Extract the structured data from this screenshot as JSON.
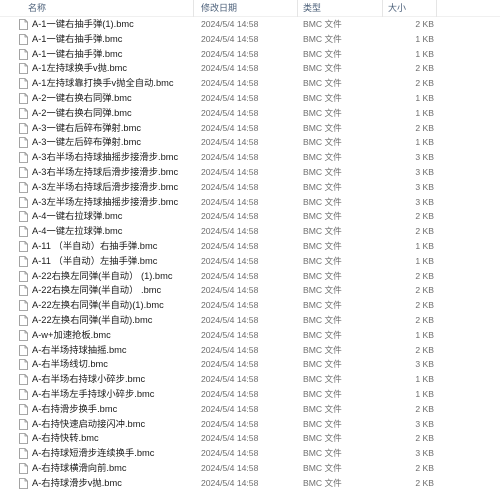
{
  "header": {
    "name_label": "名称",
    "date_label": "修改日期",
    "type_label": "类型",
    "size_label": "大小"
  },
  "files": [
    {
      "name": "A-1一键右抽手弹(1).bmc",
      "date": "2024/5/4 14:58",
      "type": "BMC 文件",
      "size": "2 KB"
    },
    {
      "name": "A-1一键右抽手弹.bmc",
      "date": "2024/5/4 14:58",
      "type": "BMC 文件",
      "size": "1 KB"
    },
    {
      "name": "A-1一键右抽手弹.bmc",
      "date": "2024/5/4 14:58",
      "type": "BMC 文件",
      "size": "1 KB"
    },
    {
      "name": "A-1左持球换手v抛.bmc",
      "date": "2024/5/4 14:58",
      "type": "BMC 文件",
      "size": "2 KB"
    },
    {
      "name": "A-1左持球靠打换手v抛全自动.bmc",
      "date": "2024/5/4 14:58",
      "type": "BMC 文件",
      "size": "2 KB"
    },
    {
      "name": "A-2一键右换右同弹.bmc",
      "date": "2024/5/4 14:58",
      "type": "BMC 文件",
      "size": "1 KB"
    },
    {
      "name": "A-2一键右换右同弹.bmc",
      "date": "2024/5/4 14:58",
      "type": "BMC 文件",
      "size": "1 KB"
    },
    {
      "name": "A-3一键右后碎布弹射.bmc",
      "date": "2024/5/4 14:58",
      "type": "BMC 文件",
      "size": "2 KB"
    },
    {
      "name": "A-3一键左后碎布弹射.bmc",
      "date": "2024/5/4 14:58",
      "type": "BMC 文件",
      "size": "1 KB"
    },
    {
      "name": "A-3右半场右持球抽摇步接滑步.bmc",
      "date": "2024/5/4 14:58",
      "type": "BMC 文件",
      "size": "3 KB"
    },
    {
      "name": "A-3右半场左持球后滑步接滑步.bmc",
      "date": "2024/5/4 14:58",
      "type": "BMC 文件",
      "size": "3 KB"
    },
    {
      "name": "A-3左半场右持球后滑步接滑步.bmc",
      "date": "2024/5/4 14:58",
      "type": "BMC 文件",
      "size": "3 KB"
    },
    {
      "name": "A-3左半场左持球抽摇步接滑步.bmc",
      "date": "2024/5/4 14:58",
      "type": "BMC 文件",
      "size": "3 KB"
    },
    {
      "name": "A-4一键右拉球弹.bmc",
      "date": "2024/5/4 14:58",
      "type": "BMC 文件",
      "size": "2 KB"
    },
    {
      "name": "A-4一键左拉球弹.bmc",
      "date": "2024/5/4 14:58",
      "type": "BMC 文件",
      "size": "2 KB"
    },
    {
      "name": "A-11 （半自动）右抽手弹.bmc",
      "date": "2024/5/4 14:58",
      "type": "BMC 文件",
      "size": "1 KB"
    },
    {
      "name": "A-11 （半自动）左抽手弹.bmc",
      "date": "2024/5/4 14:58",
      "type": "BMC 文件",
      "size": "1 KB"
    },
    {
      "name": "A-22右换左同弹(半自动） (1).bmc",
      "date": "2024/5/4 14:58",
      "type": "BMC 文件",
      "size": "2 KB"
    },
    {
      "name": "A-22右换左同弹(半自动） .bmc",
      "date": "2024/5/4 14:58",
      "type": "BMC 文件",
      "size": "2 KB"
    },
    {
      "name": "A-22左换右同弹(半自动)(1).bmc",
      "date": "2024/5/4 14:58",
      "type": "BMC 文件",
      "size": "2 KB"
    },
    {
      "name": "A-22左换右同弹(半自动).bmc",
      "date": "2024/5/4 14:58",
      "type": "BMC 文件",
      "size": "2 KB"
    },
    {
      "name": "A-w+加速抢板.bmc",
      "date": "2024/5/4 14:58",
      "type": "BMC 文件",
      "size": "1 KB"
    },
    {
      "name": "A-右半场持球抽摇.bmc",
      "date": "2024/5/4 14:58",
      "type": "BMC 文件",
      "size": "2 KB"
    },
    {
      "name": "A-右半场线切.bmc",
      "date": "2024/5/4 14:58",
      "type": "BMC 文件",
      "size": "3 KB"
    },
    {
      "name": "A-右半场右持球小碎步.bmc",
      "date": "2024/5/4 14:58",
      "type": "BMC 文件",
      "size": "1 KB"
    },
    {
      "name": "A-右半场左手持球小碎步.bmc",
      "date": "2024/5/4 14:58",
      "type": "BMC 文件",
      "size": "1 KB"
    },
    {
      "name": "A-右持滑步换手.bmc",
      "date": "2024/5/4 14:58",
      "type": "BMC 文件",
      "size": "2 KB"
    },
    {
      "name": "A-右持快速启动接闪冲.bmc",
      "date": "2024/5/4 14:58",
      "type": "BMC 文件",
      "size": "3 KB"
    },
    {
      "name": "A-右持快转.bmc",
      "date": "2024/5/4 14:58",
      "type": "BMC 文件",
      "size": "2 KB"
    },
    {
      "name": "A-右持球短滑步连续换手.bmc",
      "date": "2024/5/4 14:58",
      "type": "BMC 文件",
      "size": "3 KB"
    },
    {
      "name": "A-右持球横滑向前.bmc",
      "date": "2024/5/4 14:58",
      "type": "BMC 文件",
      "size": "2 KB"
    },
    {
      "name": "A-右持球滑步v抛.bmc",
      "date": "2024/5/4 14:58",
      "type": "BMC 文件",
      "size": "2 KB"
    }
  ]
}
